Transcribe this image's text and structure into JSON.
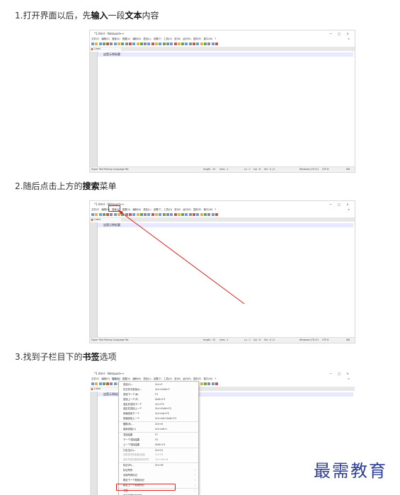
{
  "steps": [
    {
      "prefix": "1.打开界面以后，先",
      "bold1": "输入",
      "middle": "一段",
      "bold2": "文本",
      "suffix": "内容"
    },
    {
      "prefix": "2.随后点击上方的",
      "bold1": "搜索",
      "middle": "菜单",
      "bold2": "",
      "suffix": ""
    },
    {
      "prefix": "3.找到子栏目下的",
      "bold1": "书签",
      "middle": "选项",
      "bold2": "",
      "suffix": ""
    }
  ],
  "app": {
    "title": "*1.html - Notepad++",
    "menus": [
      "文件(F)",
      "编辑(E)",
      "搜索(S)",
      "视图(V)",
      "编码(N)",
      "语言(L)",
      "设置(T)",
      "工具(O)",
      "宏(M)",
      "运行(R)",
      "插件(P)",
      "窗口(W)",
      "?"
    ],
    "tab_label": "1.html",
    "editor_text": "这是示例标题",
    "status": {
      "file_type": "Hyper Text Markup Language file",
      "length": "length : 15",
      "lines": "lines : 1",
      "ln": "Ln : 1",
      "col": "Col : 6",
      "sel": "Sel : 0 | 0",
      "eol": "Windows (CR LF)",
      "encoding": "UTF-8",
      "mode": "INS"
    },
    "window_controls": {
      "minimize": "—",
      "maximize": "□",
      "close": "×"
    }
  },
  "search_menu": [
    {
      "label": "查找(F)...",
      "shortcut": "Ctrl+F"
    },
    {
      "label": "在文件中查找(I)...",
      "shortcut": "Ctrl+Shift+F"
    },
    {
      "label": "查找下一个(N)",
      "shortcut": "F3"
    },
    {
      "label": "查找上一个(P)",
      "shortcut": "Shift+F3"
    },
    {
      "label": "选定并查找下一个",
      "shortcut": "Ctrl+F3"
    },
    {
      "label": "选定并查找上一个",
      "shortcut": "Ctrl+Shift+F3"
    },
    {
      "label": "快速查找下一个",
      "shortcut": "Ctrl+Alt+F3"
    },
    {
      "label": "快速查找上一个",
      "shortcut": "Ctrl+Alt+Shift+F3"
    },
    {
      "label": "替换(R)...",
      "shortcut": "Ctrl+H"
    },
    {
      "label": "增量查找(C)",
      "shortcut": "Ctrl+Alt+I"
    },
    {
      "label": "寻找结果",
      "shortcut": "F7"
    },
    {
      "label": "下一个寻找结果",
      "shortcut": "F4"
    },
    {
      "label": "上一个寻找结果",
      "shortcut": "Shift+F4"
    },
    {
      "label": "行定位(G)...",
      "shortcut": "Ctrl+G"
    },
    {
      "label": "匹配括号的起始/结束",
      "shortcut": "Ctrl+B"
    },
    {
      "label": "选中所有匹配括号间字符",
      "shortcut": "Ctrl+Alt+B"
    },
    {
      "label": "标记(M)...",
      "shortcut": "Ctrl+M"
    },
    {
      "label": "标记所有",
      "shortcut": ""
    },
    {
      "label": "清除所有标记",
      "shortcut": ""
    },
    {
      "label": "跳至下一个颜色标记",
      "shortcut": ""
    },
    {
      "label": "跳至上一个颜色标记",
      "shortcut": ""
    },
    {
      "label": "书签",
      "shortcut": ""
    },
    {
      "label": "查找范围内的字符...",
      "shortcut": ""
    }
  ],
  "watermark": "最需教育",
  "colors": {
    "highlight": "#e02020",
    "current_line": "#e8e8ff",
    "watermark": "#2f3f99"
  }
}
